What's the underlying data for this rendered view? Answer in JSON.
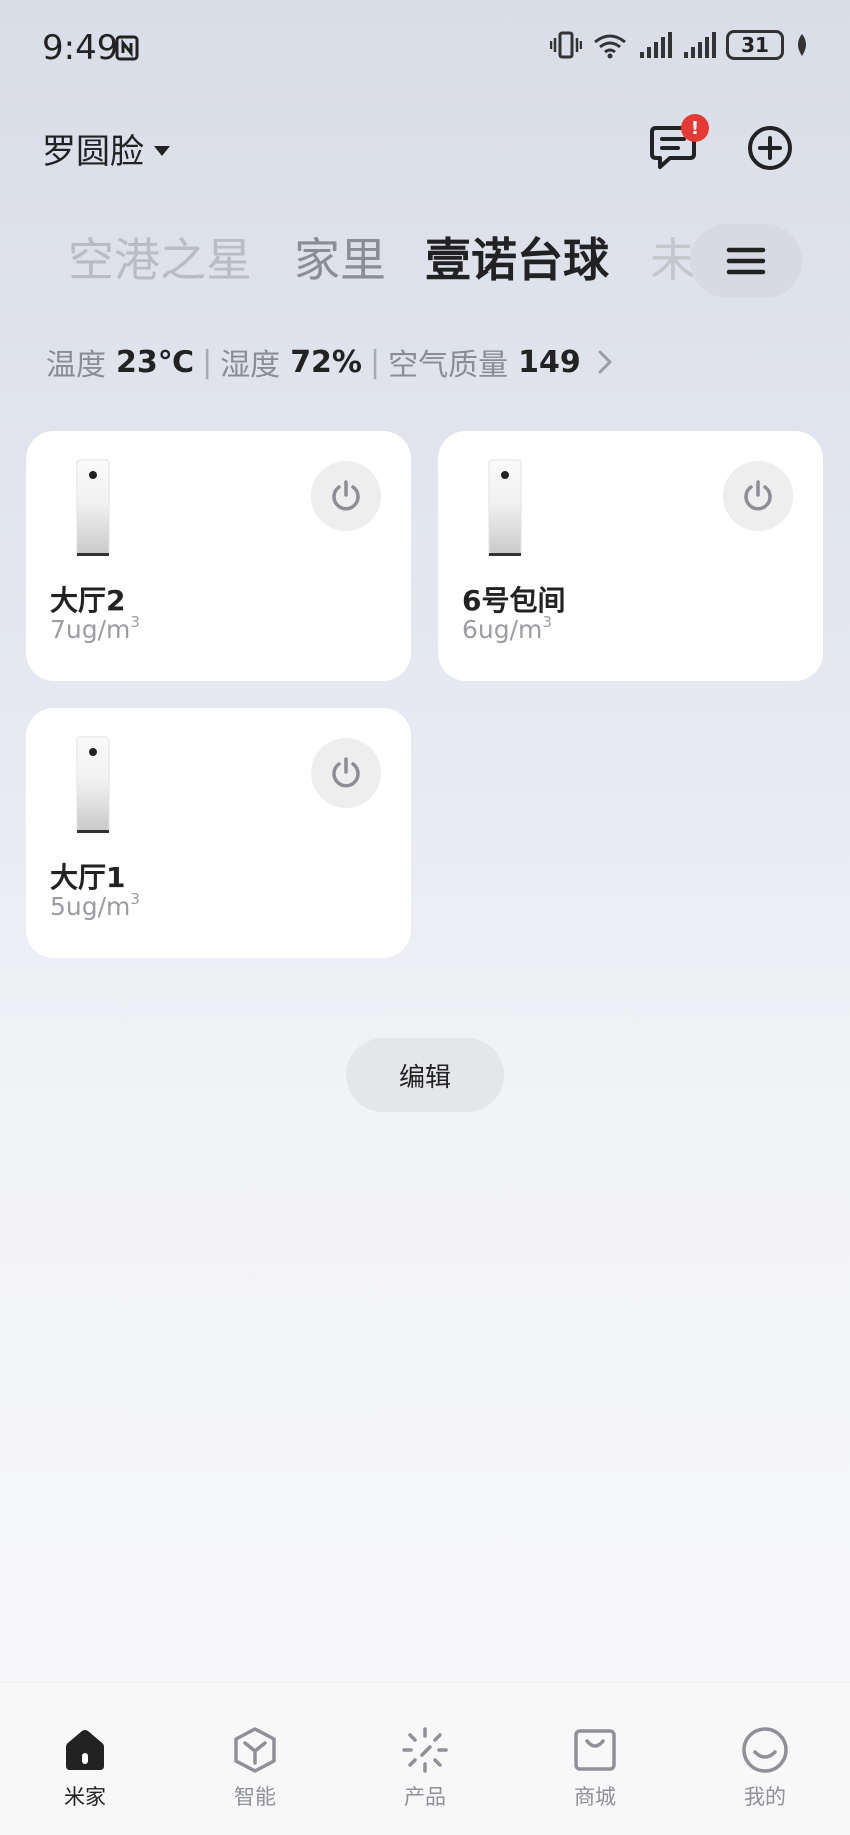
{
  "status_bar": {
    "time": "9:49",
    "battery": "31"
  },
  "header": {
    "home_name": "罗圆脸",
    "message_badge": "!"
  },
  "tabs": [
    "空港之星",
    "家里",
    "壹诺台球",
    "未"
  ],
  "env": {
    "temp_label": "温度",
    "temp_value": "23℃",
    "humidity_label": "湿度",
    "humidity_value": "72%",
    "aq_label": "空气质量",
    "aq_value": "149"
  },
  "devices": [
    {
      "name": "大厅2",
      "value": "7ug/m",
      "unit_sup": "3"
    },
    {
      "name": "6号包间",
      "value": "6ug/m",
      "unit_sup": "3"
    },
    {
      "name": "大厅1",
      "value": "5ug/m",
      "unit_sup": "3"
    }
  ],
  "edit_label": "编辑",
  "nav": [
    "米家",
    "智能",
    "产品",
    "商城",
    "我的"
  ]
}
